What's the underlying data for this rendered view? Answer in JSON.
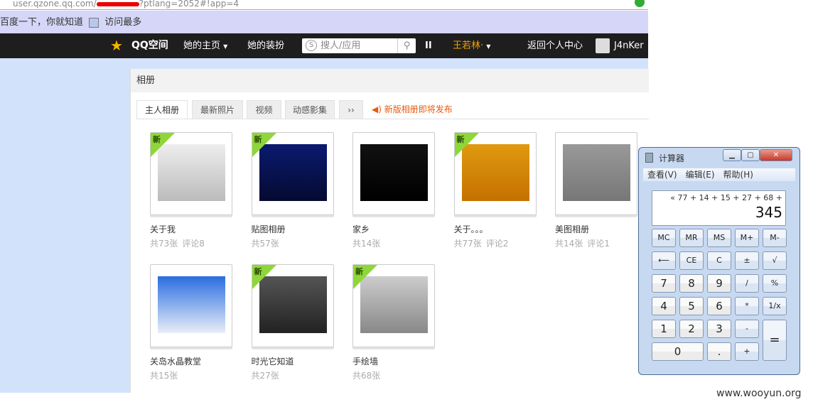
{
  "browser": {
    "url_host": "user.qzone.qq.com/",
    "url_rest": "?ptlang=2052#!app=4",
    "bookmarks": [
      "百度一下，你就知道",
      "访问最多"
    ]
  },
  "nav": {
    "logo": "QQ空间",
    "home": "她的主页",
    "dress": "她的装扮",
    "search_placeholder": "搜人/应用",
    "user_dropdown": "王若林·",
    "back": "返回个人中心",
    "me": "J4nKer"
  },
  "album": {
    "title": "相册",
    "tabs": [
      "主人相册",
      "最新照片",
      "视频",
      "动感影集"
    ],
    "more": "››",
    "notice": "新版相册即将发布",
    "new_badge": "新",
    "items": [
      {
        "name": "关于我",
        "count": "共73张",
        "comments": "评论8",
        "new": true,
        "colors": [
          "#eee",
          "#bbb"
        ]
      },
      {
        "name": "贴图相册",
        "count": "共57张",
        "new": true,
        "colors": [
          "#0a1a70",
          "#050a30"
        ]
      },
      {
        "name": "家乡",
        "count": "共14张",
        "new": false,
        "colors": [
          "#111",
          "#000"
        ]
      },
      {
        "name": "关于。。。",
        "count": "共77张",
        "comments": "评论2",
        "new": true,
        "colors": [
          "#e09a10",
          "#c57000"
        ]
      },
      {
        "name": "美图相册",
        "count": "共14张",
        "comments": "评论1",
        "new": false,
        "colors": [
          "#999",
          "#777"
        ]
      },
      {
        "name": "关岛水晶教堂",
        "count": "共15张",
        "new": false,
        "colors": [
          "#2a6de0",
          "#e8eef8"
        ]
      },
      {
        "name": "时光它知道",
        "count": "共27张",
        "new": true,
        "colors": [
          "#555",
          "#222"
        ]
      },
      {
        "name": "手绘墙",
        "count": "共68张",
        "new": true,
        "colors": [
          "#ccc",
          "#888"
        ]
      }
    ]
  },
  "calculator": {
    "title": "计算器",
    "menu": [
      "查看(V)",
      "编辑(E)",
      "帮助(H)"
    ],
    "expression": "« 77 + 14 + 15 + 27 + 68 +",
    "value": "345",
    "keys": [
      "MC",
      "MR",
      "MS",
      "M+",
      "M-",
      "⟵",
      "CE",
      "C",
      "±",
      "√",
      "7",
      "8",
      "9",
      "/",
      "%",
      "4",
      "5",
      "6",
      "*",
      "1/x",
      "1",
      "2",
      "3",
      "-",
      "=",
      "0",
      ".",
      "+"
    ]
  },
  "watermark": "www.wooyun.org"
}
